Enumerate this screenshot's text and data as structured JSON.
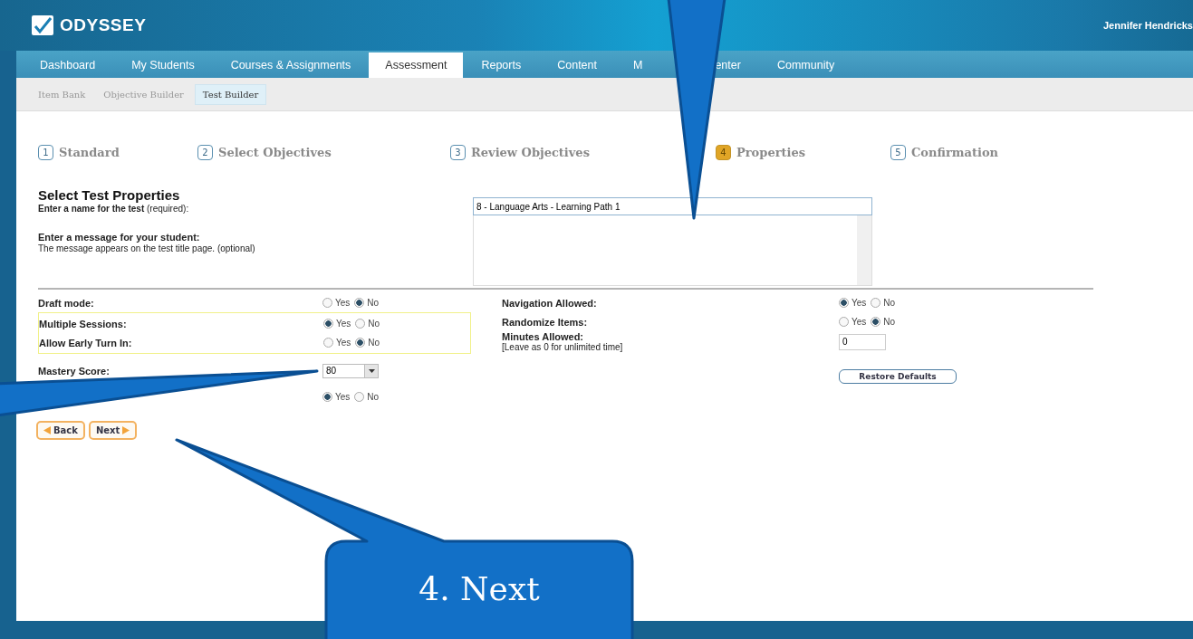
{
  "header": {
    "brand": "ODYSSEY",
    "user": "Jennifer Hendricks"
  },
  "nav_tabs": [
    {
      "label_parts": [
        "Dashboard"
      ],
      "selected": false
    },
    {
      "label_parts": [
        "My Students"
      ],
      "selected": false
    },
    {
      "label_parts": [
        "Courses & Assignments"
      ],
      "selected": false
    },
    {
      "label_parts": [
        "Assessment"
      ],
      "selected": true
    },
    {
      "label_parts": [
        "Reports"
      ],
      "selected": false
    },
    {
      "label_parts": [
        "Content"
      ],
      "selected": false
    },
    {
      "label_parts": [
        "M",
        "enter"
      ],
      "selected": false
    },
    {
      "label_parts": [
        "Community"
      ],
      "selected": false
    }
  ],
  "sub_tabs": [
    {
      "label": "Item Bank",
      "selected": false
    },
    {
      "label": "Objective Builder",
      "selected": false
    },
    {
      "label": "Test Builder",
      "selected": true
    }
  ],
  "steps": [
    {
      "number": "1",
      "label": "Standard",
      "selected": false
    },
    {
      "number": "2",
      "label": "Select Objectives",
      "selected": false
    },
    {
      "number": "3",
      "label": "Review Objectives",
      "selected": false
    },
    {
      "number": "4",
      "label": "Properties",
      "selected": true
    },
    {
      "number": "5",
      "label": "Confirmation",
      "selected": false
    }
  ],
  "form": {
    "title": "Select Test Properties",
    "name_label": "**Enter a name for the test** (required):",
    "name_value": "8 - Language Arts - Learning Path 1",
    "message_label": "Enter a message for your student:",
    "message_hint": "The message appears on the test title page. (optional)"
  },
  "left_options": [
    {
      "kind": "radio",
      "label": "Draft mode:",
      "highlight": false,
      "options": [
        {
          "label": "Yes",
          "selected": false
        },
        {
          "label": "No",
          "selected": true
        }
      ]
    },
    {
      "kind": "radio",
      "label": "Multiple Sessions:",
      "highlight": true,
      "options": [
        {
          "label": "Yes",
          "selected": true
        },
        {
          "label": "No",
          "selected": false
        }
      ]
    },
    {
      "kind": "radio",
      "label": "Allow Early Turn In:",
      "highlight": true,
      "options": [
        {
          "label": "Yes",
          "selected": false
        },
        {
          "label": "No",
          "selected": true
        }
      ]
    },
    {
      "kind": "select",
      "label": "Mastery Score:",
      "highlight": false,
      "value": "80"
    },
    {
      "kind": "radio",
      "highlight": false,
      "options": [
        {
          "label": "Yes",
          "selected": true
        },
        {
          "label": "No",
          "selected": false
        }
      ]
    }
  ],
  "right_options": [
    {
      "kind": "radio",
      "label": "Navigation Allowed:",
      "options": [
        {
          "label": "Yes",
          "selected": true
        },
        {
          "label": "No",
          "selected": false
        }
      ]
    },
    {
      "kind": "radio",
      "label": "Randomize Items:",
      "options": [
        {
          "label": "Yes",
          "selected": false
        },
        {
          "label": "No",
          "selected": true
        }
      ]
    },
    {
      "kind": "input",
      "label": "Minutes Allowed:",
      "hint": "[Leave as 0 for unlimited time]",
      "value": "0"
    },
    {
      "kind": "button",
      "label": "Restore Defaults"
    }
  ],
  "nav_buttons": [
    {
      "label": "Back",
      "kind": "back"
    },
    {
      "label": "Next",
      "kind": "next"
    }
  ],
  "callouts": [
    {
      "kind": "top_pointer"
    },
    {
      "kind": "left_pointer"
    },
    {
      "kind": "box",
      "text": "4. Next"
    }
  ]
}
